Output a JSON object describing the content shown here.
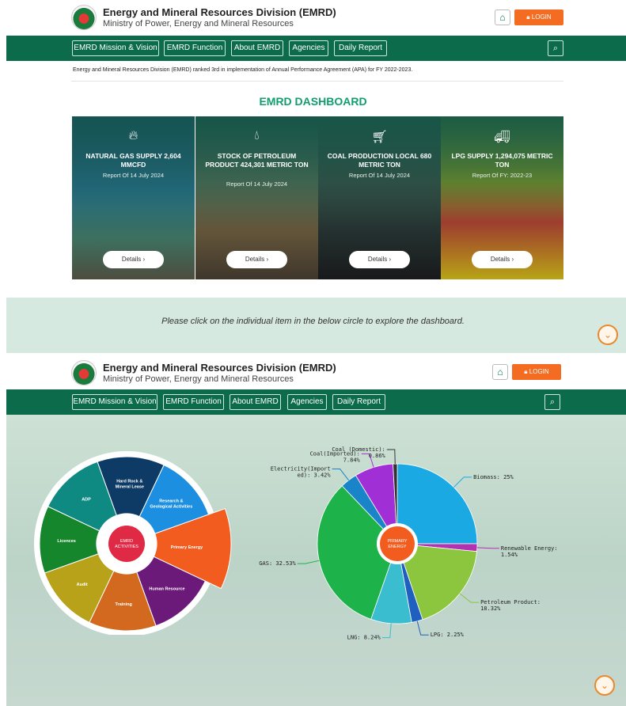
{
  "header": {
    "title": "Energy and Mineral Resources Division (EMRD)",
    "subtitle": "Ministry of Power, Energy and Mineral Resources",
    "login_label": "LOGIN",
    "home_icon": "home-icon",
    "login_icon": "lock-icon"
  },
  "nav": {
    "items": [
      "EMRD Mission & Vision",
      "EMRD Function",
      "About EMRD",
      "Agencies",
      "Daily Report"
    ],
    "search_icon": "search-icon"
  },
  "ticker": "Energy and Mineral Resources Division (EMRD) ranked 3rd in implementation of Annual Performance Agreement (APA) for FY 2022-2023.",
  "dashboard": {
    "title": "EMRD DASHBOARD",
    "details_label": "Details",
    "cards": [
      {
        "title": "NATURAL GAS SUPPLY 2,604 MMCFD",
        "date": "Report Of 14 July 2024",
        "icon": "flame-icon"
      },
      {
        "title": "STOCK OF PETROLEUM PRODUCT 424,301 METRIC TON",
        "date": "Report Of 14 July 2024",
        "icon": "oil-drop-icon"
      },
      {
        "title": "COAL PRODUCTION LOCAL 680 METRIC TON",
        "date": "Report Of 14 July 2024",
        "icon": "coal-cart-icon"
      },
      {
        "title": "LPG SUPPLY 1,294,075 METRIC TON",
        "date": "Report Of FY: 2022-23",
        "icon": "gas-cylinder-icon"
      }
    ]
  },
  "banner": {
    "text": "Please click on the individual item in the below circle to explore the dashboard.",
    "scroll_icon": "chevron-down-icon"
  },
  "activities": {
    "center": "EMRD ACTIVITIES",
    "segments": [
      "Hard Rock & Mineral Lease",
      "Research & Geological Activities",
      "Primary Energy",
      "Human Resource",
      "Training",
      "Audit",
      "Licences",
      "ADP"
    ],
    "colors": [
      "#0d3b66",
      "#1d8fe1",
      "#f25c1f",
      "#6c1a7a",
      "#d2691e",
      "#b8a21a",
      "#16862d",
      "#0e8a83"
    ]
  },
  "chart_data": {
    "type": "pie",
    "center_label": "PRIMARY ENERGY",
    "series": [
      {
        "values": [
          {
            "label": "Biomass: 25%",
            "value": 25,
            "color": "#1aa9e2"
          },
          {
            "label": "Renewable Energy: 1.54%",
            "value": 1.54,
            "color": "#b232b0"
          },
          {
            "label": "Petroleum Product: 18.32%",
            "value": 18.32,
            "color": "#8cc63f"
          },
          {
            "label": "LPG: 2.25%",
            "value": 2.25,
            "color": "#1e5fbf"
          },
          {
            "label": "LNG: 8.24%",
            "value": 8.24,
            "color": "#3bbdd0"
          },
          {
            "label": "GAS: 32.53%",
            "value": 32.53,
            "color": "#1db34a"
          },
          {
            "label": "Electricity(Imported): 3.42%",
            "value": 3.42,
            "color": "#1a84c8"
          },
          {
            "label": "Coal(Imported): 7.84%",
            "value": 7.84,
            "color": "#a12fd6"
          },
          {
            "label": "Coal (Domestic): 0.86%",
            "value": 0.86,
            "color": "#333333"
          }
        ]
      }
    ]
  }
}
